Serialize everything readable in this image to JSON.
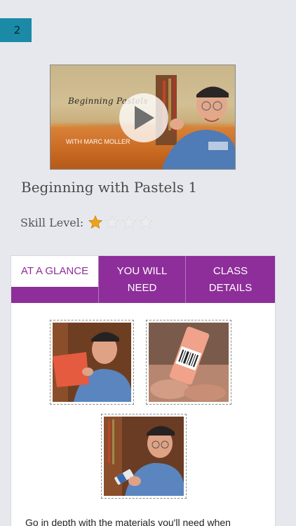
{
  "badge": {
    "text": "2"
  },
  "video": {
    "title_overlay": "Beginning Pastels",
    "subtitle_overlay": "WITH MARC MOLLER",
    "play_icon": "play-icon"
  },
  "course": {
    "title": "Beginning with Pastels 1",
    "skill_label": "Skill Level:",
    "skill_level": 1,
    "skill_max": 4
  },
  "tabs": [
    {
      "label": "AT A GLANCE",
      "active": true
    },
    {
      "label": "YOU WILL NEED",
      "active": false
    },
    {
      "label": "CLASS DETAILS",
      "active": false
    }
  ],
  "glance": {
    "description": "Go in depth with the materials you'll need when"
  },
  "colors": {
    "accent": "#8e2e9a",
    "badge": "#1a8aa6",
    "star_on": "#f0a414",
    "star_off": "#ececec"
  }
}
